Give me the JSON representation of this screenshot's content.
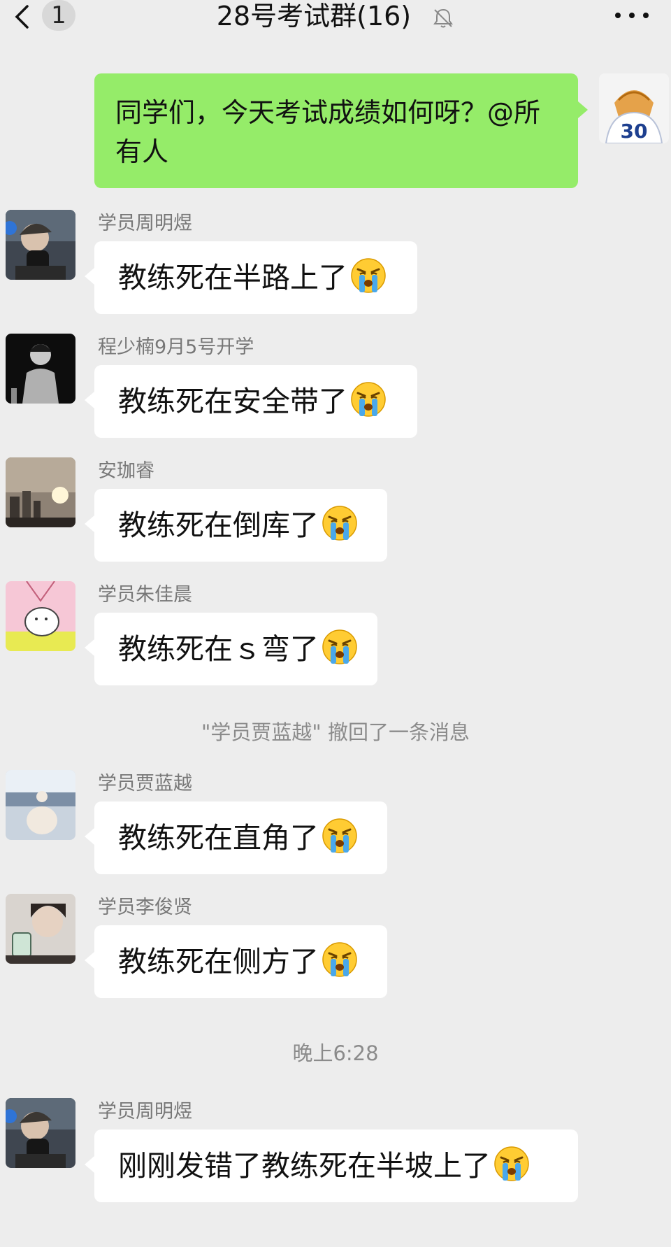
{
  "header": {
    "unread_count": "1",
    "title": "28号考试群(16)",
    "icons": [
      "chevron-left-icon",
      "mute-bell-icon",
      "more-dots-icon"
    ]
  },
  "my_message": {
    "text": "同学们，今天考试成绩如何呀？@所有人",
    "avatar_jersey_number": "30"
  },
  "messages": [
    {
      "sender": "学员周明煜",
      "text": "教练死在半路上了"
    },
    {
      "sender": "程少楠9月5号开学",
      "text": "教练死在安全带了"
    },
    {
      "sender": "安珈睿",
      "text": "教练死在倒库了"
    },
    {
      "sender": "学员朱佳晨",
      "text": "教练死在ｓ弯了"
    },
    {
      "sender": "学员贾蓝越",
      "text": "教练死在直角了"
    },
    {
      "sender": "学员李俊贤",
      "text": "教练死在侧方了"
    },
    {
      "sender": "学员周明煜",
      "text": "刚刚发错了教练死在半坡上了"
    }
  ],
  "recall_notice": "\"学员贾蓝越\" 撤回了一条消息",
  "timestamp": "晚上6:28",
  "colors": {
    "background": "#ededed",
    "sent_bubble": "#95ec69",
    "received_bubble": "#ffffff",
    "meta_text": "#8b8b8b"
  }
}
